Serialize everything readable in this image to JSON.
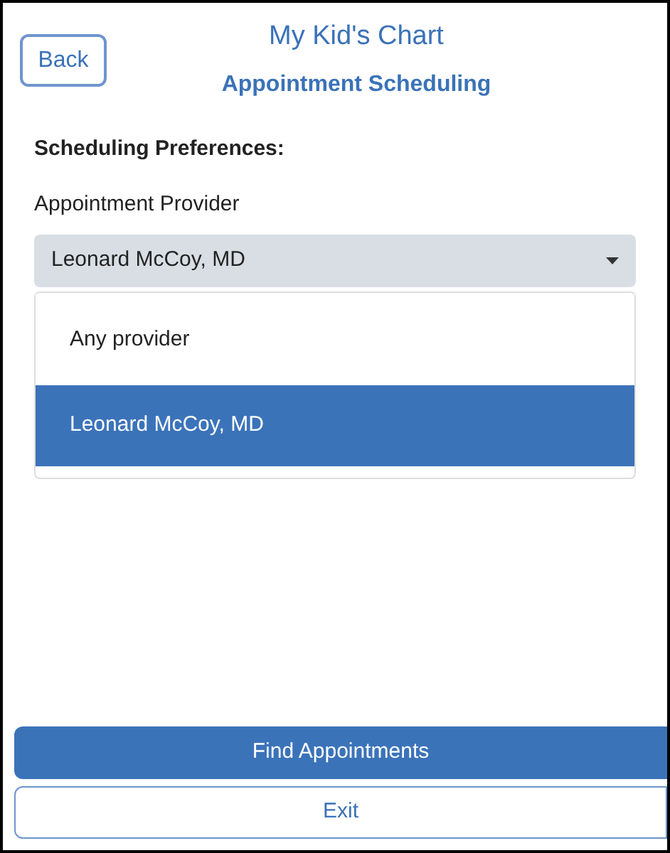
{
  "header": {
    "back_button": "Back",
    "title": "My Kid's Chart",
    "subtitle": "Appointment Scheduling"
  },
  "section_title": "Scheduling Preferences:",
  "provider_select": {
    "label": "Appointment Provider",
    "value": "Leonard McCoy, MD",
    "expanded": true,
    "options": [
      {
        "label": "Any provider",
        "selected": false
      },
      {
        "label": "Leonard McCoy, MD",
        "selected": true
      }
    ]
  },
  "buttons": [
    {
      "label": "Find Appointments",
      "kind": "primary"
    },
    {
      "label": "Exit",
      "kind": "secondary"
    }
  ]
}
